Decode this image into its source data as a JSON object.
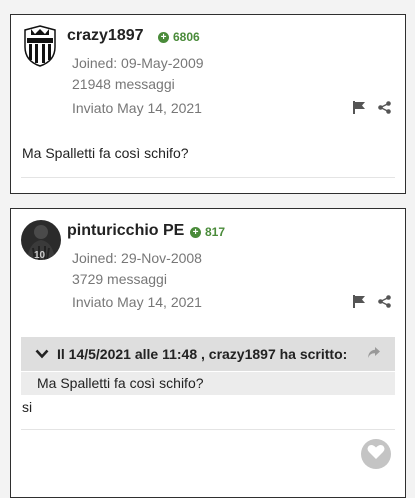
{
  "posts": [
    {
      "username": "crazy1897",
      "reputation": "6806",
      "joined": "Joined: 09-May-2009",
      "messages": "21948 messaggi",
      "posted": "Inviato May 14, 2021",
      "content": "Ma Spalletti fa così schifo?"
    },
    {
      "username": "pinturicchio PE",
      "reputation": "817",
      "joined": "Joined: 29-Nov-2008",
      "messages": "3729 messaggi",
      "posted": "Inviato May 14, 2021",
      "quote": {
        "header": "Il 14/5/2021 alle 11:48 , crazy1897 ha scritto:",
        "text": "Ma Spalletti fa così schifo?"
      },
      "content": "si"
    }
  ],
  "colors": {
    "reputation": "#4a8b3a",
    "quote_header_bg": "#dedede",
    "quote_body_bg": "#ececec",
    "like_button_bg": "#c4c4c4"
  },
  "icons": [
    "juventus-logo",
    "reputation-plus-icon",
    "report-flag-icon",
    "share-icon",
    "chevron-down-icon",
    "quote-share-icon",
    "heart-icon"
  ]
}
